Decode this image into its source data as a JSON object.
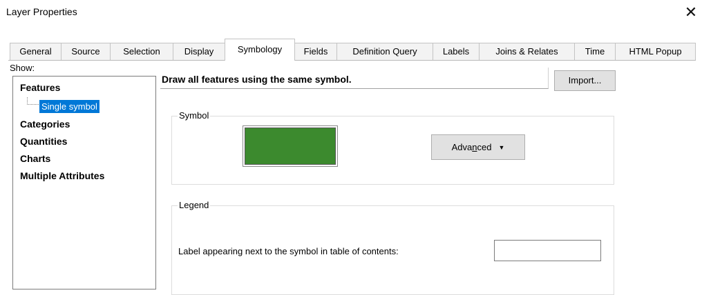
{
  "window": {
    "title": "Layer Properties",
    "close_glyph": "✕"
  },
  "tabs": [
    {
      "label": "General"
    },
    {
      "label": "Source"
    },
    {
      "label": "Selection"
    },
    {
      "label": "Display"
    },
    {
      "label": "Symbology",
      "active": true
    },
    {
      "label": "Fields"
    },
    {
      "label": "Definition Query"
    },
    {
      "label": "Labels"
    },
    {
      "label": "Joins & Relates"
    },
    {
      "label": "Time"
    },
    {
      "label": "HTML Popup"
    }
  ],
  "show": {
    "label": "Show:",
    "items": [
      "Features",
      "Categories",
      "Quantities",
      "Charts",
      "Multiple Attributes"
    ],
    "selected_subitem": "Single symbol"
  },
  "symbology": {
    "description": "Draw all features using the same symbol.",
    "import_label": "Import...",
    "symbol_group_label": "Symbol",
    "symbol_color": "#3c8a2e",
    "advanced_label_pre": "Adva",
    "advanced_label_mnemonic": "n",
    "advanced_label_post": "ced",
    "legend_group_label": "Legend",
    "legend_field_label": "Label appearing next to the symbol in table of contents:",
    "legend_field_value": ""
  },
  "colors": {
    "accent": "#0078d7",
    "button_bg": "#e1e1e1"
  }
}
